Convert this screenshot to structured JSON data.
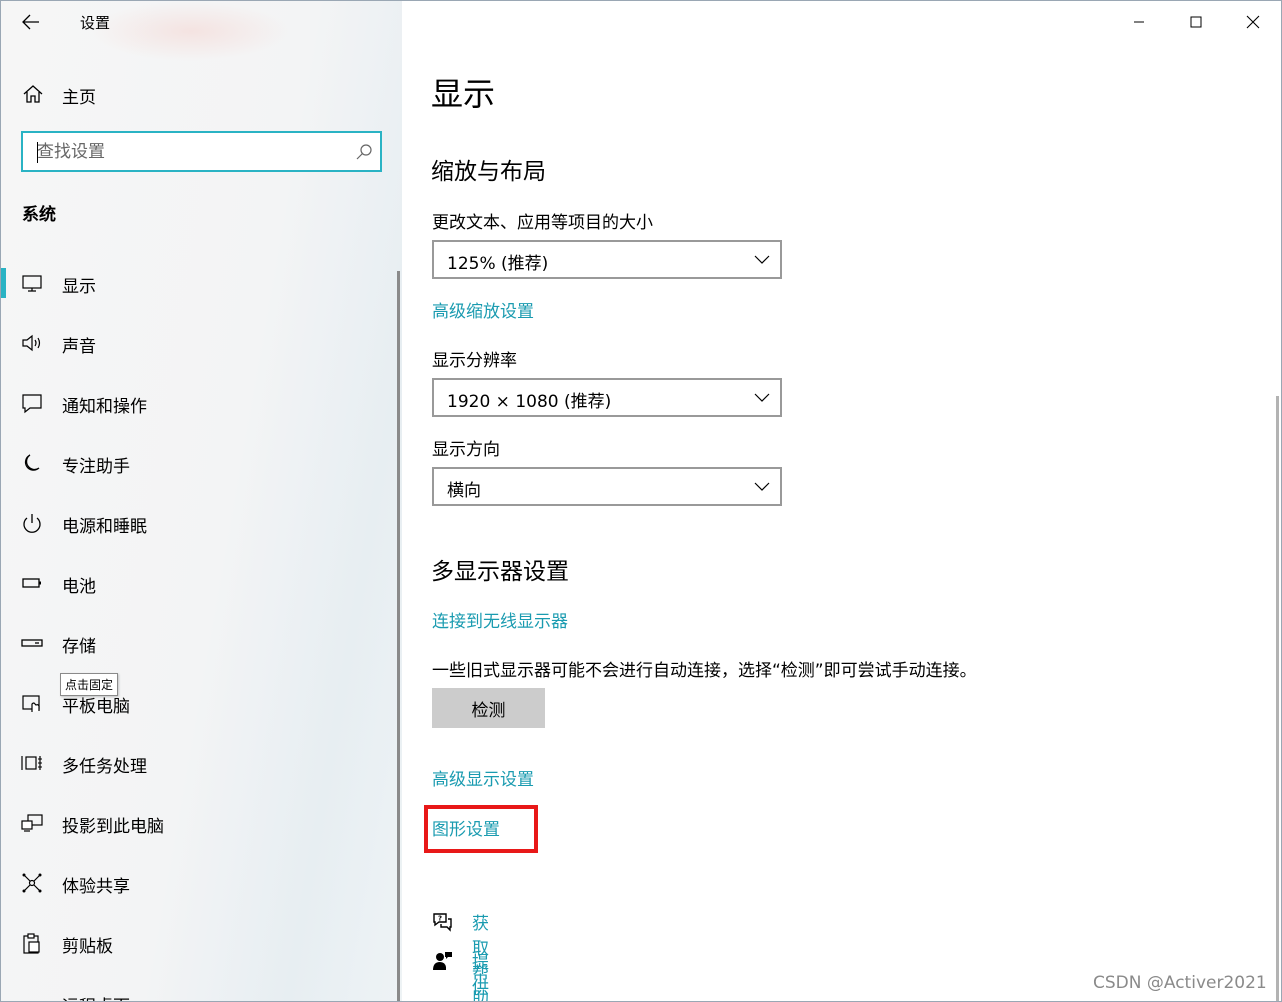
{
  "window": {
    "title": "设置",
    "controls": {
      "minimize_icon": "minimize-icon",
      "maximize_icon": "maximize-icon",
      "close_icon": "close-icon"
    }
  },
  "sidebar": {
    "home_label": "主页",
    "search_placeholder": "查找设置",
    "section_label": "系统",
    "items": [
      {
        "label": "显示",
        "icon": "monitor-icon",
        "active": true
      },
      {
        "label": "声音",
        "icon": "speaker-icon"
      },
      {
        "label": "通知和操作",
        "icon": "notification-icon"
      },
      {
        "label": "专注助手",
        "icon": "moon-icon"
      },
      {
        "label": "电源和睡眠",
        "icon": "power-icon"
      },
      {
        "label": "电池",
        "icon": "battery-icon"
      },
      {
        "label": "存储",
        "icon": "storage-icon"
      },
      {
        "label": "平板电脑",
        "icon": "tablet-icon"
      },
      {
        "label": "多任务处理",
        "icon": "multitask-icon"
      },
      {
        "label": "投影到此电脑",
        "icon": "project-icon"
      },
      {
        "label": "体验共享",
        "icon": "share-icon"
      },
      {
        "label": "剪贴板",
        "icon": "clipboard-icon"
      },
      {
        "label": "远程桌面",
        "icon": "remote-desktop-icon"
      }
    ],
    "tooltip": "点击固定"
  },
  "main": {
    "page_title": "显示",
    "scale_section": {
      "heading": "缩放与布局",
      "scale_label": "更改文本、应用等项目的大小",
      "scale_value": "125% (推荐)",
      "advanced_scaling_link": "高级缩放设置",
      "resolution_label": "显示分辨率",
      "resolution_value": "1920 × 1080 (推荐)",
      "orientation_label": "显示方向",
      "orientation_value": "横向"
    },
    "multi_display": {
      "heading": "多显示器设置",
      "wireless_link": "连接到无线显示器",
      "description": "一些旧式显示器可能不会进行自动连接，选择“检测”即可尝试手动连接。",
      "detect_button": "检测",
      "advanced_display_link": "高级显示设置",
      "graphics_link": "图形设置"
    },
    "help": {
      "get_help": "获取帮助",
      "feedback": "提供反馈"
    }
  },
  "watermark": "CSDN @Activer2021",
  "colors": {
    "accent": "#2ab3c4",
    "link": "#1a9bb0",
    "highlight": "#e81818",
    "button_bg": "#cccccc"
  }
}
